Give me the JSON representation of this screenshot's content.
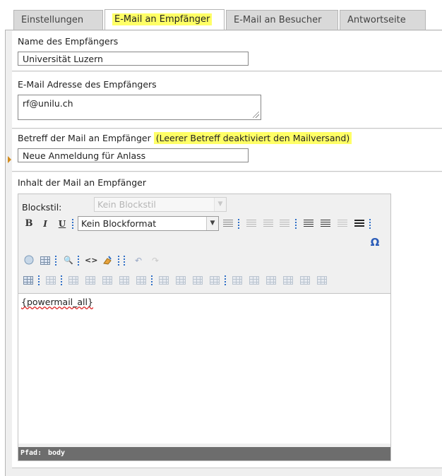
{
  "tabs": [
    {
      "label": "Einstellungen",
      "active": false
    },
    {
      "label": "E-Mail an Empfänger",
      "active": true
    },
    {
      "label": "E-Mail an Besucher",
      "active": false
    },
    {
      "label": "Antwortseite",
      "active": false
    }
  ],
  "fields": {
    "recipient_name": {
      "label": "Name des Empfängers",
      "value": "Universität Luzern"
    },
    "recipient_email": {
      "label": "E-Mail Adresse des Empfängers",
      "value": "rf@unilu.ch"
    },
    "subject": {
      "label": "Betreff der Mail an Empfänger",
      "hint": "(Leerer Betreff deaktiviert den Mailversand)",
      "value": "Neue Anmeldung für Anlass"
    },
    "content": {
      "label": "Inhalt der Mail an Empfänger"
    }
  },
  "editor": {
    "blockstyle_label": "Blockstil:",
    "blockstyle_value": "Kein Blockstil",
    "blockformat_value": "Kein Blockformat",
    "buttons": {
      "bold": "B",
      "italic": "I",
      "underline": "U",
      "omega": "Ω",
      "find": "🔍",
      "source": "<>"
    },
    "content_text": "{powermail_all}",
    "path_label": "Pfad:",
    "path_value": "body"
  },
  "colors": {
    "highlight": "#ffff66",
    "status_bar": "#6d6d6d",
    "accent": "#2f6fc7"
  }
}
